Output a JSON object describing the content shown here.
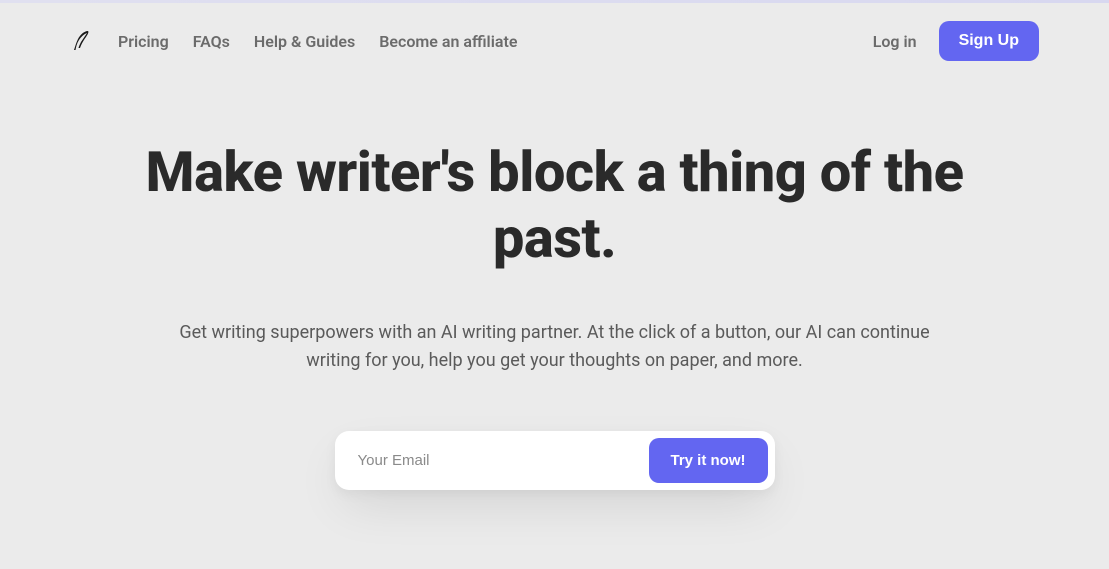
{
  "nav": {
    "links": {
      "pricing": "Pricing",
      "faqs": "FAQs",
      "help": "Help & Guides",
      "affiliate": "Become an affiliate"
    },
    "login": "Log in",
    "signup": "Sign Up"
  },
  "hero": {
    "title": "Make writer's block a thing of the past.",
    "subtitle": "Get writing superpowers with an AI writing partner. At the click of a button, our AI can continue writing for you, help you get your thoughts on paper, and more."
  },
  "form": {
    "email_placeholder": "Your Email",
    "cta": "Try it now!"
  }
}
